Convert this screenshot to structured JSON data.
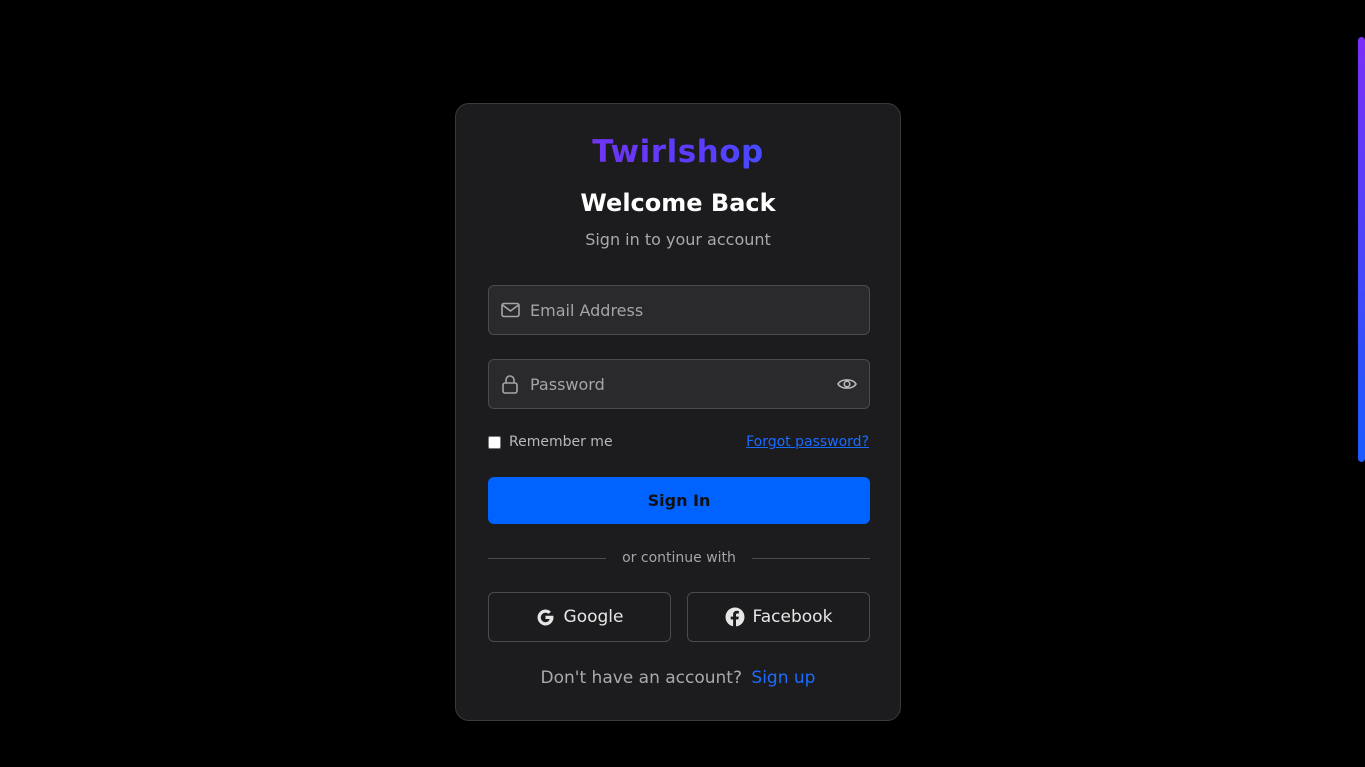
{
  "brand": {
    "name": "Twirlshop",
    "gradient_start": "#8a2be2",
    "gradient_end": "#1e6bff"
  },
  "header": {
    "title": "Welcome Back",
    "subtitle": "Sign in to your account"
  },
  "form": {
    "email": {
      "icon": "mail-icon",
      "placeholder": "Email Address",
      "value": ""
    },
    "password": {
      "icon": "lock-icon",
      "placeholder": "Password",
      "value": "",
      "toggle_icon": "eye-icon"
    },
    "remember_label": "Remember me",
    "remember_checked": false,
    "forgot_label": "Forgot password?",
    "submit_label": "Sign In"
  },
  "divider_text": "or continue with",
  "social": {
    "google_label": "Google",
    "google_icon": "google-icon",
    "facebook_label": "Facebook",
    "facebook_icon": "facebook-icon"
  },
  "footer": {
    "prompt": "Don't have an account?",
    "signup_label": "Sign up"
  },
  "colors": {
    "background": "#000000",
    "card": "#1c1c1e",
    "accent": "#0062ff",
    "link": "#1a6bff"
  }
}
